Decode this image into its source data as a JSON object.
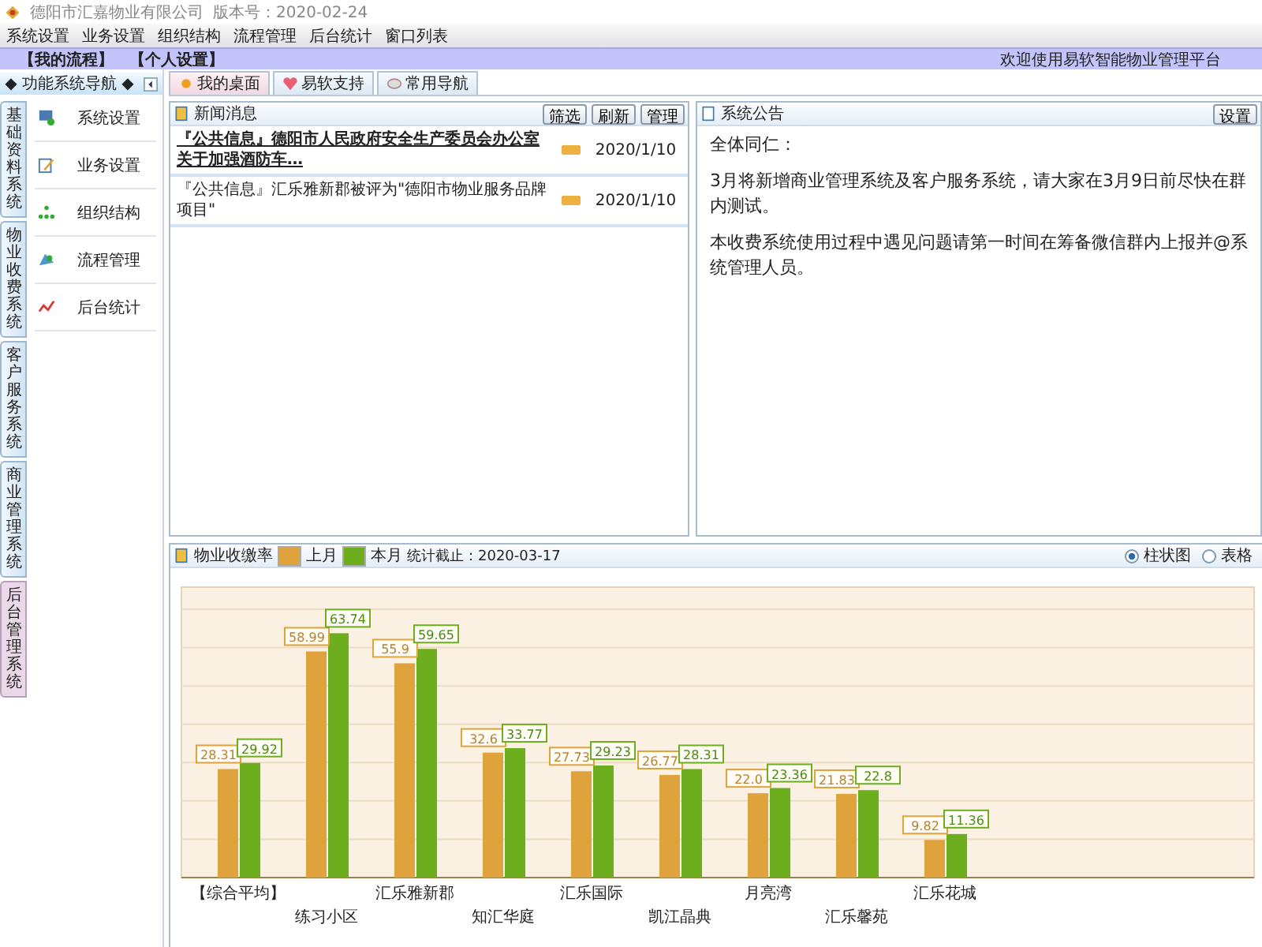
{
  "app": {
    "company": "德阳市汇嘉物业有限公司",
    "version": "版本号：2020-02-24"
  },
  "menu": [
    "系统设置",
    "业务设置",
    "组织结构",
    "流程管理",
    "后台统计",
    "窗口列表"
  ],
  "user_bar": {
    "links": [
      "【我的流程】",
      "【个人设置】"
    ],
    "welcome": "欢迎使用易软智能物业管理平台"
  },
  "sidebar": {
    "title": "◆ 功能系统导航 ◆",
    "systems": [
      {
        "label": "基础资料系统",
        "selected": false
      },
      {
        "label": "物业收费系统",
        "selected": false
      },
      {
        "label": "客户服务系统",
        "selected": false
      },
      {
        "label": "商业管理系统",
        "selected": false
      },
      {
        "label": "后台管理系统",
        "selected": true
      }
    ],
    "items": [
      "系统设置",
      "业务设置",
      "组织结构",
      "流程管理",
      "后台统计"
    ]
  },
  "tabs": [
    {
      "label": "我的桌面",
      "selected": true
    },
    {
      "label": "易软支持",
      "selected": false
    },
    {
      "label": "常用导航",
      "selected": false
    }
  ],
  "news": {
    "title": "新闻消息",
    "buttons": [
      "筛选",
      "刷新",
      "管理"
    ],
    "rows": [
      {
        "text": "『公共信息』德阳市人民政府安全生产委员会办公室关于加强酒防车…",
        "date": "2020/1/10",
        "unread": true
      },
      {
        "text": "『公共信息』汇乐雅新郡被评为\"德阳市物业服务品牌项目\"",
        "date": "2020/1/10",
        "unread": false
      }
    ]
  },
  "notice": {
    "title": "系统公告",
    "button": "设置",
    "lines": [
      "全体同仁：",
      "3月将新增商业管理系统及客户服务系统，请大家在3月9日前尽快在群内测试。",
      "本收费系统使用过程中遇见问题请第一时间在筹备微信群内上报并@系统管理人员。"
    ]
  },
  "collection": {
    "title": "物业收缴率",
    "as_of": "统计截止：2020-03-17",
    "views": [
      {
        "label": "柱状图",
        "selected": true
      },
      {
        "label": "表格",
        "selected": false
      }
    ],
    "chart_data": {
      "type": "bar",
      "categories": [
        "【综合平均】",
        "练习小区",
        "汇乐雅新郡",
        "知汇华庭",
        "汇乐国际",
        "凯江晶典",
        "月亮湾",
        "汇乐馨苑",
        "汇乐花城"
      ],
      "ylim": [
        0,
        70
      ],
      "data_labels": true,
      "series": [
        {
          "name": "上月",
          "color": "#e0a23c",
          "values": [
            28.31,
            58.99,
            55.9,
            32.6,
            27.73,
            26.77,
            22.0,
            21.83,
            9.82
          ],
          "value_labels": [
            "28.31",
            "58.99",
            "55.9",
            "32.6",
            "27.73",
            "26.77",
            "22.0",
            "21.83",
            "9.82"
          ]
        },
        {
          "name": "本月",
          "color": "#6cae1e",
          "values": [
            29.92,
            63.74,
            59.65,
            33.77,
            29.23,
            28.31,
            23.36,
            22.8,
            11.36
          ],
          "value_labels": [
            "29.92",
            "63.74",
            "59.65",
            "33.77",
            "29.23",
            "28.31",
            "23.36",
            "22.8",
            "11.36"
          ]
        }
      ]
    }
  }
}
